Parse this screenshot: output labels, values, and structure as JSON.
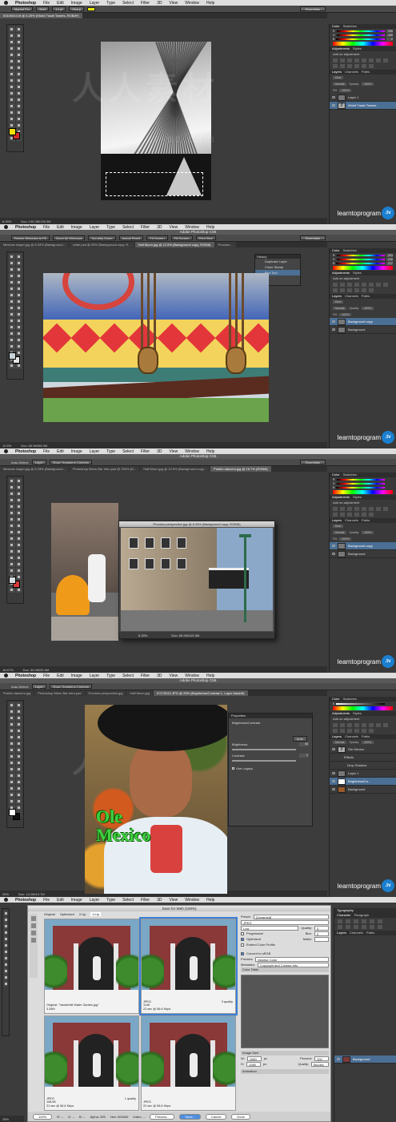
{
  "watermark": {
    "cn": "人人素材",
    "url": "www.rr-sc.com"
  },
  "brand": {
    "text": "learntoprogram",
    "badge": ".tv"
  },
  "common": {
    "menu": [
      "Photoshop",
      "File",
      "Edit",
      "Image",
      "Layer",
      "Type",
      "Select",
      "Filter",
      "3D",
      "View",
      "Window",
      "Help"
    ],
    "app_title": "Adobe Photoshop CS6",
    "workspace": "Essentials",
    "panel_tabs_color": [
      "Color",
      "Swatches"
    ],
    "panel_tabs_adj": [
      "Adjustments",
      "Styles"
    ],
    "add_adjustment": "Add an adjustment",
    "panel_tabs_layers": [
      "Layers",
      "Channels",
      "Paths"
    ],
    "blend_mode": "Normal",
    "opacity_label": "Opacity:",
    "opacity": "100%",
    "fill_label": "Fill:",
    "fill": "100%",
    "kind": "Kind"
  },
  "shot1": {
    "doc_tab": "00100010.tif @ 6.25% (World Trade Towers, RGB/8*)",
    "font_family": "Myriad Pro",
    "font_style": "Bold",
    "font_size": "14 pt",
    "aa": "Sharp",
    "color_values": {
      "r": "255",
      "g": "255",
      "b": "0"
    },
    "layers": [
      "Layer 1",
      "World Trade Towers"
    ],
    "zoom": "6.25%",
    "doc_size": "Doc: 130.2M/139.3M",
    "fg_color": "#f2e205",
    "bg_color": "#d12c2c"
  },
  "shot2": {
    "options": [
      "Resize Windows to Fit",
      "Zoom All Windows",
      "Scrubby Zoom",
      "Actual Pixels",
      "Fit Screen",
      "Fill Screen",
      "Print Size"
    ],
    "tabs": [
      "Mexican singer.jpg @ 8.33% (Background...",
      "white.psd @ 50% (Background copy, R...",
      "Half Moon.jpg @ 12.5% (Background copy, RGB/8)",
      "Proctors..."
    ],
    "history_title": "History",
    "history": [
      "Duplicate Layer",
      "Clone Stamp",
      "Blur Tool"
    ],
    "color_values": {
      "r": "203",
      "g": "210",
      "b": "217"
    },
    "layers": [
      "Background copy",
      "Background"
    ],
    "zoom": "12.5%",
    "doc_size": "Doc: 65.9M/65.9M",
    "fg_color": "#c9d2d8",
    "bg_color": "#e1e6ea"
  },
  "shot3": {
    "options": [
      "Auto-Select:",
      "Layer",
      "Show Transform Controls"
    ],
    "tabs": [
      "Mexican singer.jpg @ 8.33% (Background...",
      "Photoshop Menu Bar Intro.psd @ 200% (D...",
      "Half Moon.jpg @ 12.5% (Background copy...",
      "Pueblo dancers.jpg @ 16.7% (RGB/8)"
    ],
    "floating_title": "Proctors perspective.jpg @ 8.33% (Background copy, RGB/8)",
    "floating_zoom": "8.33%",
    "floating_doc": "Doc: 65.2M/125.3M",
    "layers": [
      "Background copy",
      "Background"
    ],
    "zoom": "16.67%",
    "doc_size": "Doc: 30.0M/30.0M",
    "fg_color": "#d9dde1",
    "bg_color": "#d63a3a"
  },
  "shot4": {
    "options": [
      "Auto-Select:",
      "Layer",
      "Show Transform Controls"
    ],
    "tabs": [
      "Pueblo dancers.jpg",
      "Photoshop Menu Bar Intro.psd",
      "Proctors perspective.jpg",
      "Half Moon.jpg",
      "6?1?0012.JPG @ 25% (Brightness/Contrast 1, Layer Mask/8)"
    ],
    "properties_title": "Properties",
    "properties_sub": "Brightness/Contrast",
    "auto": "Auto",
    "brightness_label": "Brightness:",
    "brightness": "58",
    "contrast_label": "Contrast:",
    "contrast": "0",
    "use_legacy": "Use Legacy",
    "overlay_text": [
      "Ole",
      "Mexico"
    ],
    "layers": [
      "Ole Mexico",
      "Effects",
      "Drop Shadow",
      "Layer 1",
      "Brightness/Co...",
      "Background"
    ],
    "zoom": "25%",
    "doc_size": "Doc: 14.1M/14.7M",
    "fg_color": "#ffffff",
    "bg_color": "#111111"
  },
  "shot5": {
    "title": "Save for Web (100%)",
    "view_tabs": [
      "Original",
      "Optimized",
      "2-Up",
      "4-Up"
    ],
    "cells": [
      {
        "line1": "Original: \"Vanderbilt Water Garden.jpg\"",
        "line2": "3.34M",
        "line3": "",
        "right": ""
      },
      {
        "line1": "JPEG",
        "line2": "114K",
        "line3": "22 sec @ 56.6 Kbps",
        "right": "3 quality"
      },
      {
        "line1": "JPEG",
        "line2": "108.6K",
        "line3": "21 sec @ 56.6 Kbps",
        "right": "1 quality"
      },
      {
        "line1": "JPEG",
        "line2": "",
        "line3": "22 sec @ 56.6 Kbps",
        "right": ""
      }
    ],
    "preset_label": "Preset:",
    "preset": "[Unnamed]",
    "format": "JPEG",
    "compression": "Low",
    "quality_label": "Quality:",
    "quality": "3",
    "blur_label": "Blur:",
    "blur": "0",
    "matte_label": "Matte:",
    "progressive": "Progressive",
    "optimized": "Optimized",
    "embed_profile": "Embed Color Profile",
    "convert_srgb": "Convert to sRGB",
    "preview_label": "Preview:",
    "preview": "Monitor Color",
    "metadata_label": "Metadata:",
    "metadata": "Copyright and Contact Info",
    "color_table": "Color Table",
    "image_size": "Image Size",
    "w_label": "W:",
    "w": "1080",
    "h_label": "H:",
    "h": "1080",
    "unit": "px",
    "percent_label": "Percent:",
    "percent": "100",
    "quality2_label": "Quality:",
    "resample": "Bicubic",
    "animation": "Animation",
    "zoom": "100%",
    "r": "R: --",
    "g": "G: --",
    "b": "B: --",
    "alpha": "Alpha: 255",
    "hex": "Hex: 000000",
    "index": "Index: --",
    "preview_btn": "Preview...",
    "save_btn": "Save...",
    "cancel_btn": "Cancel",
    "done_btn": "Done",
    "right_panel_tabs": [
      "Typography",
      "Character",
      "Paragraph"
    ],
    "right_layer": "Background",
    "zoom_pct": "25%",
    "doc_size": "Doc: 14.1M/14.7M"
  }
}
